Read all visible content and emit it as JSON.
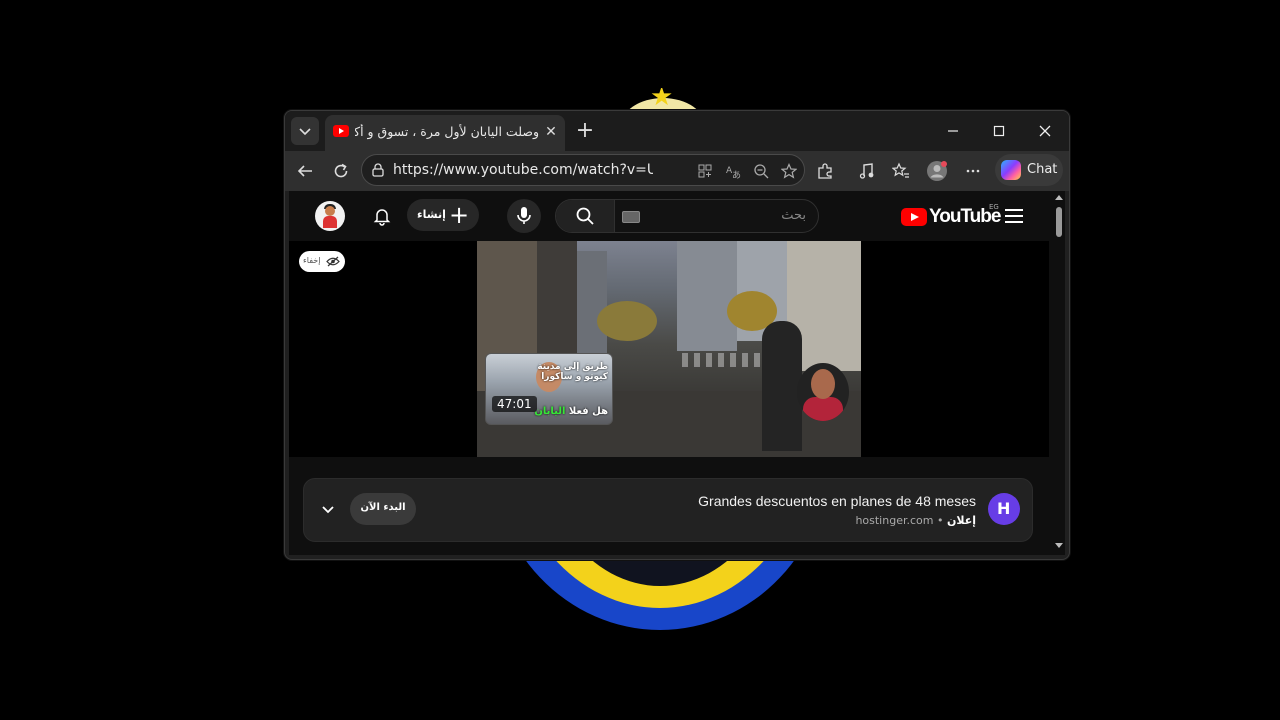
{
  "browser": {
    "tab": {
      "title": "وصلت اليابان لأول مرة ، تسوق و أكل ياباني 🇯🇵 - YouTube",
      "favicon": "youtube-favicon-icon"
    },
    "address": {
      "url": "https://www.youtube.com/watch?v=UvWt_SP..."
    },
    "chat_label": "Chat"
  },
  "youtube": {
    "create_label": "إنشاء",
    "search_placeholder": "بحث",
    "logo_text": "YouTube",
    "country_code": "EG",
    "hide_label": "إخفاء",
    "thumbnail": {
      "caption_top": "طريق إلى مدينة\nكيوتو و ساكورا",
      "caption_bottom_prefix": "هل فعلا ",
      "caption_bottom_highlight": "اليابان",
      "duration": "47:01"
    },
    "ad": {
      "headline": "Grandes descuentos en planes de 48 meses",
      "label": "إعلان",
      "separator": "•",
      "domain": "hostinger.com",
      "cta": "البدء الآن"
    }
  },
  "colors": {
    "youtube_red": "#ff0000",
    "hostinger_purple": "#673de6",
    "highlight_green": "#37e637"
  }
}
